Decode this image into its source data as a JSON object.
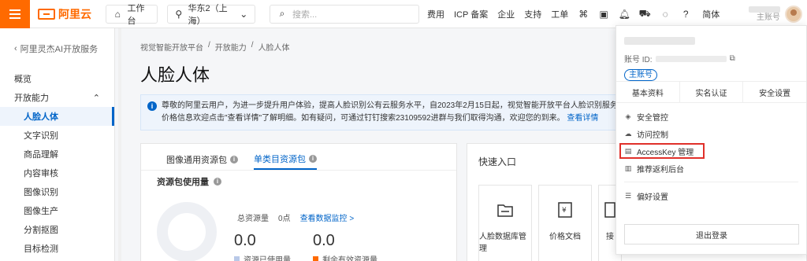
{
  "topbar": {
    "brand": "阿里云",
    "workbench": "工作台",
    "region": "华东2（上海）",
    "search_placeholder": "搜索...",
    "links": [
      "费用",
      "ICP 备案",
      "企业",
      "支持",
      "工单"
    ],
    "language": "简体",
    "account_role": "主账号"
  },
  "sidebar": {
    "back_label": "阿里灵杰AI开放服务",
    "items": [
      {
        "label": "概览"
      },
      {
        "label": "开放能力"
      },
      {
        "label": "人脸人体"
      },
      {
        "label": "文字识别"
      },
      {
        "label": "商品理解"
      },
      {
        "label": "内容审核"
      },
      {
        "label": "图像识别"
      },
      {
        "label": "图像生产"
      },
      {
        "label": "分割抠图"
      },
      {
        "label": "目标检测"
      }
    ]
  },
  "main": {
    "breadcrumb": [
      "视觉智能开放平台",
      "开放能力",
      "人脸人体"
    ],
    "title": "人脸人体",
    "notice_line1": "尊敬的阿里云用户，为进一步提升用户体验，提高人脸识别公有云服务水平，自2023年2月15日起，视觉智能开放平台人脸识别服务将下调预付",
    "notice_line2": "价格信息欢迎点击\"查看详情\"了解明细。如有疑问，可通过钉钉搜索23109592进群与我们取得沟通，欢迎您的到来。",
    "notice_link": "查看详情",
    "tabs": [
      "图像通用资源包",
      "单类目资源包"
    ],
    "usage_title": "资源包使用量",
    "total_label": "总资源量",
    "total_value": "0点",
    "monitor_link": "查看数据监控 >",
    "used_value": "0.0",
    "used_label": "资源已使用量",
    "remaining_value": "0.0",
    "remaining_label": "剩余有效资源量",
    "quick_title": "快速入口",
    "quick_tiles": [
      "人脸数据库管理",
      "价格文档",
      "接"
    ]
  },
  "dropdown": {
    "id_label": "账号 ID:",
    "badge": "主账号",
    "tabs": [
      "基本资料",
      "实名认证",
      "安全设置"
    ],
    "items": [
      "安全管控",
      "访问控制",
      "AccessKey 管理",
      "推荐返利后台"
    ],
    "preferences": "偏好设置",
    "logout": "退出登录"
  },
  "colors": {
    "brand": "#ff6a00",
    "accent": "#0064c8",
    "highlight": "#e0302a",
    "used_square": "#b9c9e8",
    "remaining_square": "#ff6a00"
  }
}
